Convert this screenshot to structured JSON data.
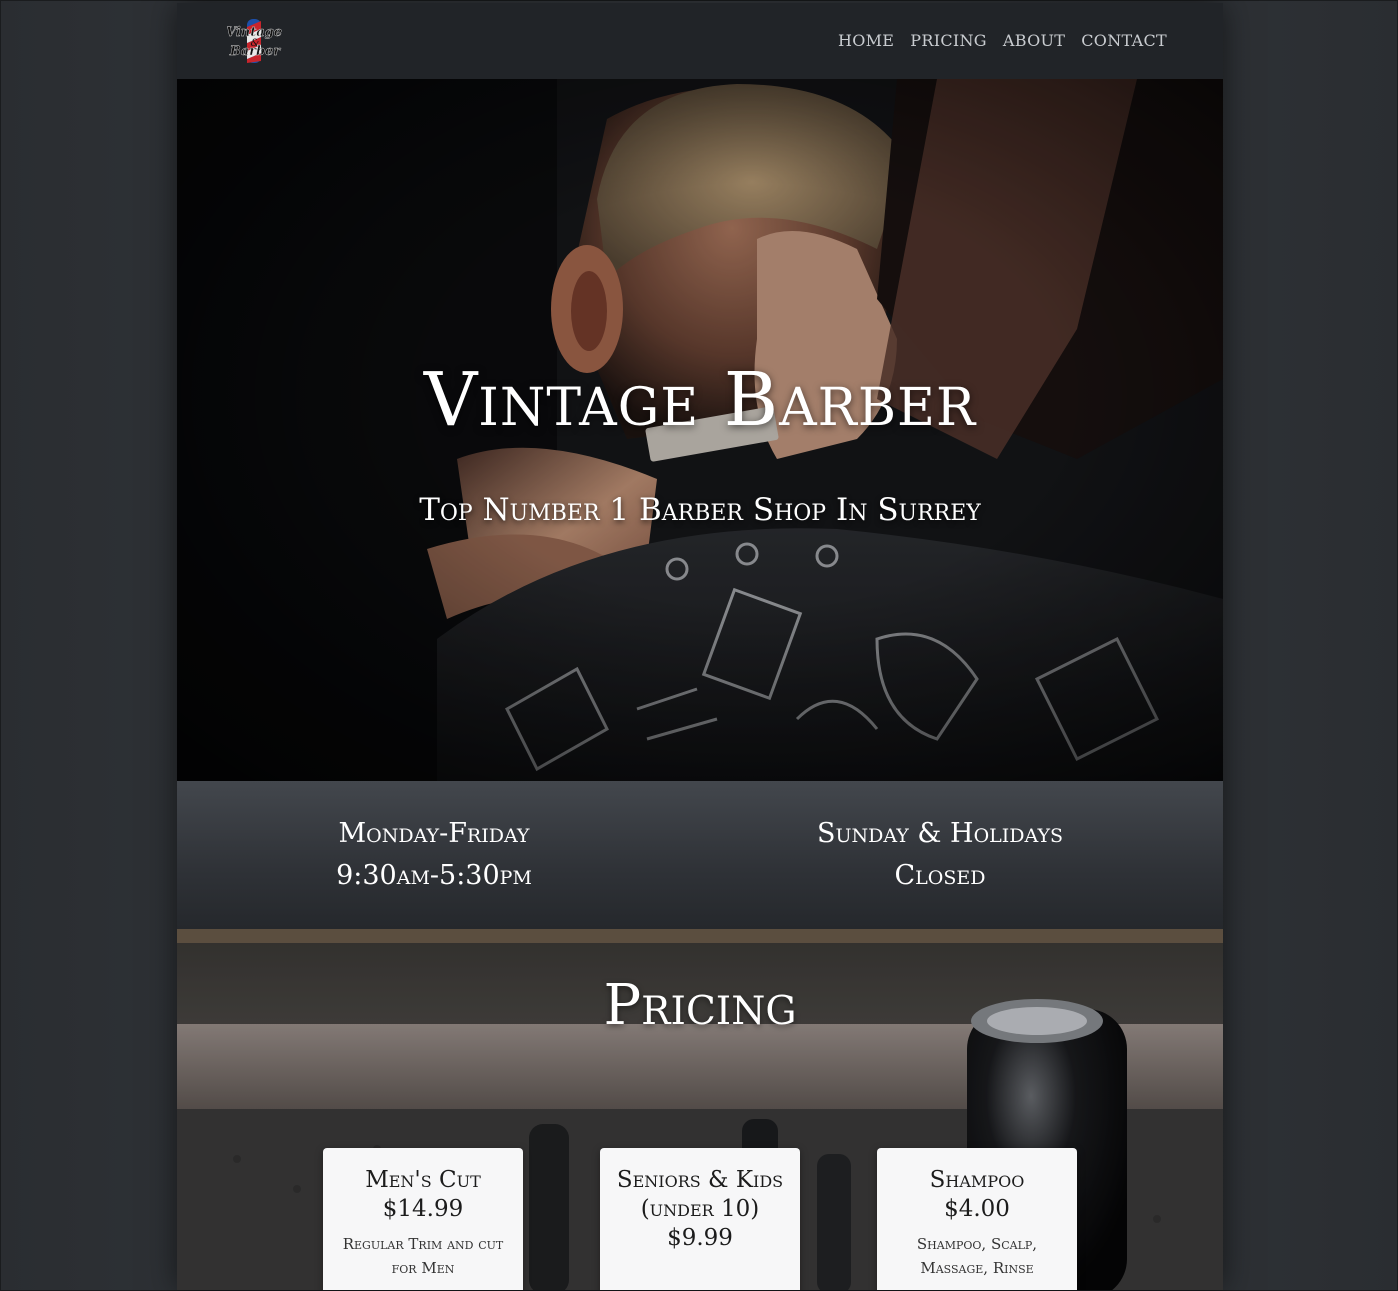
{
  "nav": {
    "logo_text_top": "Vintage",
    "logo_text_mid": "&",
    "logo_text_bottom": "Barber",
    "links": [
      {
        "label": "HOME"
      },
      {
        "label": "PRICING"
      },
      {
        "label": "ABOUT"
      },
      {
        "label": "CONTACT"
      }
    ]
  },
  "hero": {
    "title": "Vintage Barber",
    "subtitle": "Top Number 1 Barber Shop In Surrey"
  },
  "hours": {
    "weekday_days": "Monday-Friday",
    "weekday_time": "9:30am-5:30pm",
    "weekend_days": "Sunday & Holidays",
    "weekend_status": "Closed"
  },
  "pricing": {
    "title": "Pricing",
    "cards": [
      {
        "name": "Men's Cut",
        "price": "$14.99",
        "desc": "Regular Trim and cut for Men"
      },
      {
        "name": "Seniors & Kids (under 10)",
        "price": "$9.99",
        "desc": ""
      },
      {
        "name": "Shampoo",
        "price": "$4.00",
        "desc": "Shampoo, Scalp, Massage, Rinse"
      }
    ]
  },
  "colors": {
    "nav_bg": "#212428",
    "nav_text": "#c9ccd0",
    "card_bg": "#f7f7f8",
    "text_light": "#ffffff"
  }
}
